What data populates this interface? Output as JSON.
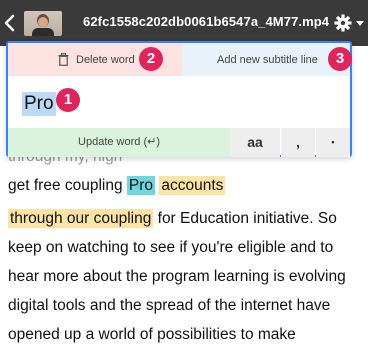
{
  "header": {
    "filename": "62fc1558c202db0061b6547a_4M77.mp4"
  },
  "popup": {
    "delete_label": "Delete word",
    "add_label": "Add new subtitle line",
    "word_value": "Pro",
    "update_label": "Update word (↵)",
    "opt_case": "aa",
    "opt_comma": ",",
    "opt_period": "•",
    "badges": [
      "1",
      "2",
      "3"
    ]
  },
  "transcript": {
    "line1_partial": "through my, high",
    "line2_start": "get free coupling ",
    "line2_word": "Pro",
    "line2_hl": "accounts",
    "line3_hl": "through our coupling",
    "line3_rest": " for Education initiative. So",
    "line4": "keep on watching to see if you're eligible and to",
    "line5": "hear more about the program learning is evolving",
    "line6": "digital tools and the spread of the internet have",
    "line7": "opened up a world of possibilities to make"
  },
  "colors": {
    "accent": "#3b82f6",
    "badge": "#e0245e",
    "highlight_yellow": "#fbe3a6",
    "highlight_cyan": "#6fd6dd"
  }
}
